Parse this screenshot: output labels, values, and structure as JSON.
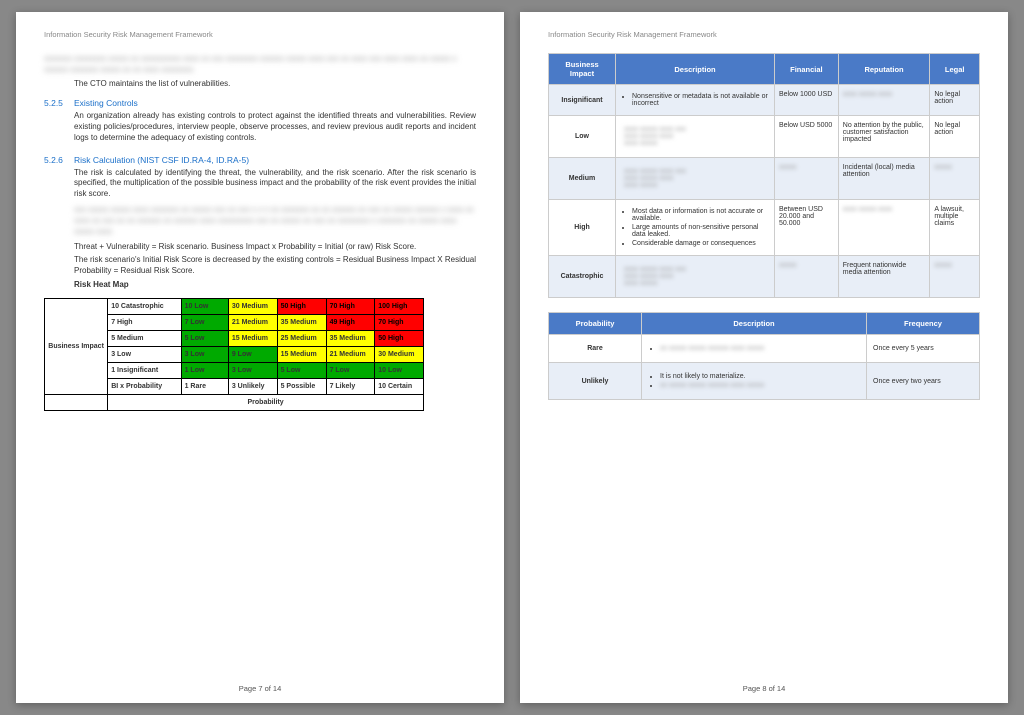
{
  "doc_title": "Information Security Risk Management Framework",
  "p7": {
    "footer": "Page 7 of 14",
    "intro": "The CTO maintains the list of vulnerabilities.",
    "s525": {
      "num": "5.2.5",
      "title": "Existing Controls",
      "body": "An organization already has existing controls to protect against the identified threats and vulnerabilities. Review existing policies/procedures, interview people, observe processes, and review previous audit reports and incident logs to determine the adequacy of existing controls."
    },
    "s526": {
      "num": "5.2.6",
      "title": "Risk Calculation (NIST CSF ID.RA-4, ID.RA-5)",
      "body": "The risk is calculated by identifying the threat, the vulnerability, and the risk scenario. After the risk scenario is specified, the multiplication of the possible business impact and the probability of the risk event provides the initial risk score."
    },
    "formula1": "Threat + Vulnerability = Risk scenario. Business Impact x Probability = Initial (or raw) Risk Score.",
    "formula2": "The risk scenario's Initial Risk Score is decreased by the existing controls = Residual Business Impact X Residual Probability = Residual Risk Score.",
    "heatTitle": "Risk Heat Map",
    "heat": {
      "side": "Business Impact",
      "rows": [
        [
          "10 Catastrophic",
          "10 Low",
          "30 Medium",
          "50 High",
          "70 High",
          "100 High"
        ],
        [
          "7 High",
          "7 Low",
          "21 Medium",
          "35 Medium",
          "49 High",
          "70 High"
        ],
        [
          "5 Medium",
          "5 Low",
          "15 Medium",
          "25 Medium",
          "35 Medium",
          "50 High"
        ],
        [
          "3 Low",
          "3 Low",
          "9 Low",
          "15 Medium",
          "21 Medium",
          "30 Medium"
        ],
        [
          "1 Insignificant",
          "1 Low",
          "3 Low",
          "5 Low",
          "7 Low",
          "10 Low"
        ],
        [
          "BI x Probability",
          "1 Rare",
          "3 Unlikely",
          "5 Possible",
          "7 Likely",
          "10 Certain"
        ]
      ],
      "colors": [
        [
          "g",
          "y",
          "r",
          "r",
          "r"
        ],
        [
          "g",
          "y",
          "y",
          "r",
          "r"
        ],
        [
          "g",
          "y",
          "y",
          "y",
          "r"
        ],
        [
          "g",
          "g",
          "y",
          "y",
          "y"
        ],
        [
          "g",
          "g",
          "g",
          "g",
          "g"
        ],
        [
          "",
          "",
          "",
          "",
          ""
        ]
      ],
      "bottom": "Probability"
    }
  },
  "p8": {
    "footer": "Page 8 of 14",
    "impact": {
      "headers": [
        "Business Impact",
        "Description",
        "Financial",
        "Reputation",
        "Legal"
      ],
      "rows": [
        {
          "l": "Insignificant",
          "d": [
            "Nonsensitive or metadata is not available or incorrect"
          ],
          "f": "Below 1000 USD",
          "r": "",
          "g": "No legal action"
        },
        {
          "l": "Low",
          "d": [
            ""
          ],
          "f": "Below USD 5000",
          "r": "No attention by the public, customer satisfaction impacted",
          "g": "No legal action"
        },
        {
          "l": "Medium",
          "d": [
            ""
          ],
          "f": "",
          "r": "Incidental (local) media attention",
          "g": ""
        },
        {
          "l": "High",
          "d": [
            "Most data or information is not accurate or available.",
            "Large amounts of non-sensitive personal data leaked.",
            "Considerable damage or consequences"
          ],
          "f": "Between USD 20.000 and 50.000",
          "r": "",
          "g": "A lawsuit, multiple claims"
        },
        {
          "l": "Catastrophic",
          "d": [
            ""
          ],
          "f": "",
          "r": "Frequent nationwide media attention",
          "g": ""
        }
      ]
    },
    "prob": {
      "headers": [
        "Probability",
        "Description",
        "Frequency"
      ],
      "rows": [
        {
          "l": "Rare",
          "d": [
            ""
          ],
          "f": "Once every 5 years"
        },
        {
          "l": "Unlikely",
          "d": [
            "It is not likely to materialize.",
            ""
          ],
          "f": "Once every two years"
        }
      ]
    }
  }
}
